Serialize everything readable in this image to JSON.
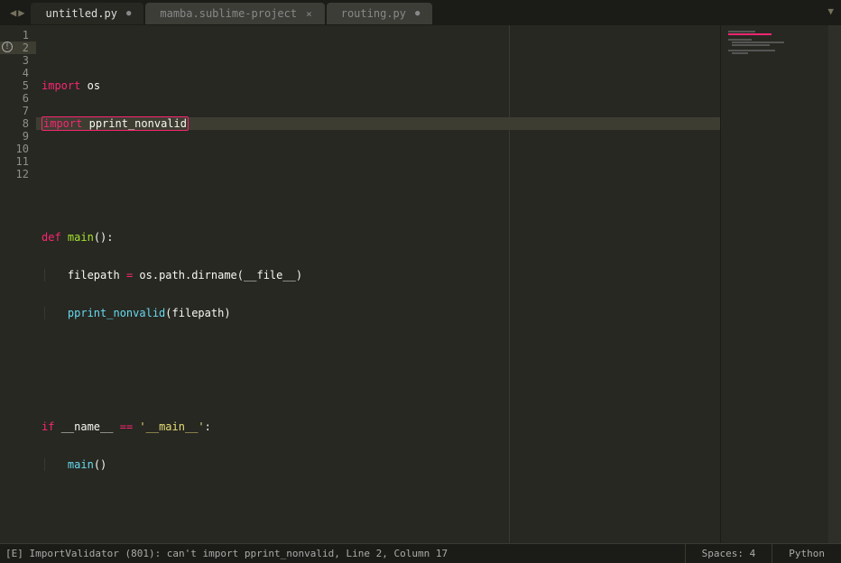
{
  "tabs": [
    {
      "label": "untitled.py",
      "active": true,
      "dirty": true
    },
    {
      "label": "mamba.sublime-project",
      "active": false,
      "dirty": false
    },
    {
      "label": "routing.py",
      "active": false,
      "dirty": true
    }
  ],
  "gutter": {
    "lines": [
      "1",
      "2",
      "3",
      "4",
      "5",
      "6",
      "7",
      "8",
      "9",
      "10",
      "11",
      "12"
    ],
    "error_line": 2
  },
  "code": {
    "l1": {
      "kw": "import",
      "mod": "os"
    },
    "l2": {
      "kw": "import",
      "mod": "pprint_nonvalid"
    },
    "l5": {
      "kw": "def",
      "name": "main",
      "paren": "():"
    },
    "l6": {
      "lhs": "filepath",
      "eq": "=",
      "call": "os.path.dirname",
      "open": "(",
      "arg": "__file__",
      "close": ")"
    },
    "l7": {
      "call": "pprint_nonvalid",
      "open": "(",
      "arg": "filepath",
      "close": ")"
    },
    "l10": {
      "kw": "if",
      "lhs": "__name__",
      "op": "==",
      "str": "'__main__'",
      "colon": ":"
    },
    "l11": {
      "call": "main",
      "paren": "()"
    },
    "guide": "│   "
  },
  "status": {
    "error": "[E] ImportValidator (801): can't import pprint_nonvalid, Line 2, Column 17",
    "spaces": "Spaces: 4",
    "syntax": "Python"
  }
}
